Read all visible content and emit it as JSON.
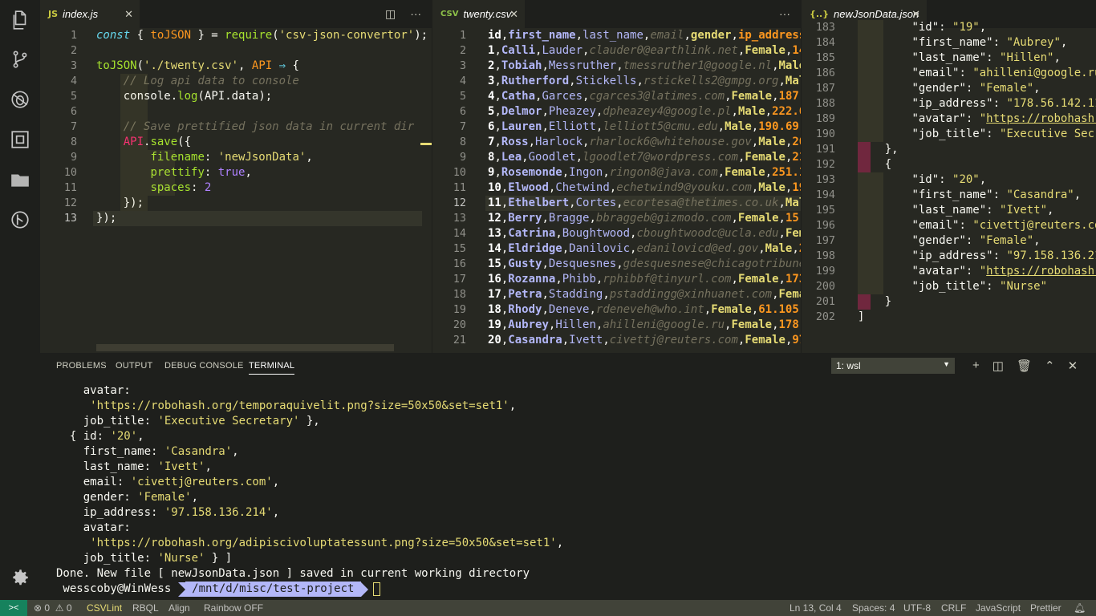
{
  "colors": {
    "editor_bg": "#272822",
    "sidebar_bg": "#1e1f1c",
    "status_bg": "#414339",
    "remote_bg": "#16825d"
  },
  "activity": [
    "files-icon",
    "source-control-icon",
    "debug-icon",
    "extensions-icon",
    "explorer-folder-icon",
    "git-graph-icon",
    "gear-icon"
  ],
  "editors": {
    "left": {
      "tab_label": "index.js",
      "tab_icon": "JS",
      "lines": [
        [
          [
            "kw",
            "const "
          ],
          [
            "pun",
            "{ "
          ],
          [
            "obj",
            "toJSON"
          ],
          [
            "pun",
            " } = "
          ],
          [
            "fn",
            "require"
          ],
          [
            "pun",
            "("
          ],
          [
            "str",
            "'csv-json-convertor'"
          ],
          [
            "pun",
            ");"
          ]
        ],
        [],
        [
          [
            "fn",
            "toJSON"
          ],
          [
            "pun",
            "("
          ],
          [
            "str",
            "'./twenty.csv'"
          ],
          [
            "pun",
            ", "
          ],
          [
            "obj",
            "API"
          ],
          [
            "pun",
            " "
          ],
          [
            "kw",
            "⇒"
          ],
          [
            "pun",
            " {"
          ]
        ],
        [
          [
            "pun",
            "    "
          ],
          [
            "cm",
            "// Log api data to console"
          ]
        ],
        [
          [
            "pun",
            "    "
          ],
          [
            "prop",
            "console"
          ],
          [
            "pun",
            "."
          ],
          [
            "fn",
            "log"
          ],
          [
            "pun",
            "("
          ],
          [
            "prop",
            "API"
          ],
          [
            "pun",
            "."
          ],
          [
            "prop",
            "data"
          ],
          [
            "pun",
            ");"
          ]
        ],
        [],
        [
          [
            "pun",
            "    "
          ],
          [
            "cm",
            "// Save prettified json data in current dir"
          ]
        ],
        [
          [
            "pun",
            "    "
          ],
          [
            "op",
            "API"
          ],
          [
            "pun",
            "."
          ],
          [
            "fn",
            "save"
          ],
          [
            "pun",
            "({"
          ]
        ],
        [
          [
            "pun",
            "        "
          ],
          [
            "fn",
            "filename"
          ],
          [
            "pun",
            ": "
          ],
          [
            "str",
            "'newJsonData'"
          ],
          [
            "pun",
            ","
          ]
        ],
        [
          [
            "pun",
            "        "
          ],
          [
            "fn",
            "prettify"
          ],
          [
            "pun",
            ": "
          ],
          [
            "num",
            "true"
          ],
          [
            "pun",
            ","
          ]
        ],
        [
          [
            "pun",
            "        "
          ],
          [
            "fn",
            "spaces"
          ],
          [
            "pun",
            ": "
          ],
          [
            "num",
            "2"
          ]
        ],
        [
          [
            "pun",
            "    "
          ],
          [
            "pun",
            "});"
          ]
        ],
        [
          [
            "pun",
            "});"
          ]
        ]
      ],
      "line_numbers": [
        "1",
        "2",
        "3",
        "4",
        "5",
        "6",
        "7",
        "8",
        "9",
        "10",
        "11",
        "12",
        "13"
      ],
      "active_line": 13
    },
    "middle": {
      "tab_label": "twenty.csv",
      "tab_icon": "CSV",
      "line_numbers": [
        "1",
        "2",
        "3",
        "4",
        "5",
        "6",
        "7",
        "8",
        "9",
        "10",
        "11",
        "12",
        "13",
        "14",
        "15",
        "16",
        "17",
        "18",
        "19",
        "20",
        "21"
      ],
      "active_line": 12,
      "rows": [
        [
          "id",
          "first_name",
          "last_name",
          "email",
          "gender",
          "ip_address"
        ],
        [
          "1",
          "Calli",
          "Lauder",
          "clauder0@earthlink.net",
          "Female",
          "14"
        ],
        [
          "2",
          "Tobiah",
          "Messruther",
          "tmessruther1@google.nl",
          "Male"
        ],
        [
          "3",
          "Rutherford",
          "Stickells",
          "rstickells2@gmpg.org",
          "Mal"
        ],
        [
          "4",
          "Catha",
          "Garces",
          "cgarces3@latimes.com",
          "Female",
          "187."
        ],
        [
          "5",
          "Delmor",
          "Pheazey",
          "dpheazey4@google.pl",
          "Male",
          "222.6"
        ],
        [
          "6",
          "Lauren",
          "Elliott",
          "lelliott5@cmu.edu",
          "Male",
          "190.69."
        ],
        [
          "7",
          "Ross",
          "Harlock",
          "rharlock6@whitehouse.gov",
          "Male",
          "20"
        ],
        [
          "8",
          "Lea",
          "Goodlet",
          "lgoodlet7@wordpress.com",
          "Female",
          "21"
        ],
        [
          "9",
          "Rosemonde",
          "Ingon",
          "ringon8@java.com",
          "Female",
          "251.1"
        ],
        [
          "10",
          "Elwood",
          "Chetwind",
          "echetwind9@youku.com",
          "Male",
          "19"
        ],
        [
          "11",
          "Ethelbert",
          "Cortes",
          "ecortesa@thetimes.co.uk",
          "Mal"
        ],
        [
          "12",
          "Berry",
          "Bragge",
          "bbraggeb@gizmodo.com",
          "Female",
          "15."
        ],
        [
          "13",
          "Catrina",
          "Boughtwood",
          "cboughtwoodc@ucla.edu",
          "Fem"
        ],
        [
          "14",
          "Eldridge",
          "Danilovic",
          "edanilovicd@ed.gov",
          "Male",
          "2"
        ],
        [
          "15",
          "Gusty",
          "Desquesnes",
          "gdesquesnese@chicagotribune"
        ],
        [
          "16",
          "Rozanna",
          "Phibb",
          "rphibbf@tinyurl.com",
          "Female",
          "173"
        ],
        [
          "17",
          "Petra",
          "Stadding",
          "pstaddingg@xinhuanet.com",
          "Fema"
        ],
        [
          "18",
          "Rhody",
          "Deneve",
          "rdeneveh@who.int",
          "Female",
          "61.105."
        ],
        [
          "19",
          "Aubrey",
          "Hillen",
          "ahilleni@google.ru",
          "Female",
          "178."
        ],
        [
          "20",
          "Casandra",
          "Ivett",
          "civettj@reuters.com",
          "Female",
          "97"
        ]
      ]
    },
    "right": {
      "tab_label": "newJsonData.json",
      "tab_icon": "{..}",
      "line_numbers": [
        "183",
        "184",
        "185",
        "186",
        "187",
        "188",
        "189",
        "190",
        "191",
        "192",
        "193",
        "194",
        "195",
        "196",
        "197",
        "198",
        "199",
        "200",
        "201",
        "202"
      ],
      "lines": [
        [
          [
            "pun",
            "        "
          ],
          [
            "key",
            "\"id\""
          ],
          [
            "pun",
            ": "
          ],
          [
            "str",
            "\"19\""
          ],
          [
            "pun",
            ","
          ]
        ],
        [
          [
            "pun",
            "        "
          ],
          [
            "key",
            "\"first_name\""
          ],
          [
            "pun",
            ": "
          ],
          [
            "str",
            "\"Aubrey\""
          ],
          [
            "pun",
            ","
          ]
        ],
        [
          [
            "pun",
            "        "
          ],
          [
            "key",
            "\"last_name\""
          ],
          [
            "pun",
            ": "
          ],
          [
            "str",
            "\"Hillen\""
          ],
          [
            "pun",
            ","
          ]
        ],
        [
          [
            "pun",
            "        "
          ],
          [
            "key",
            "\"email\""
          ],
          [
            "pun",
            ": "
          ],
          [
            "str",
            "\"ahilleni@google.ru\""
          ],
          [
            "pun",
            ","
          ]
        ],
        [
          [
            "pun",
            "        "
          ],
          [
            "key",
            "\"gender\""
          ],
          [
            "pun",
            ": "
          ],
          [
            "str",
            "\"Female\""
          ],
          [
            "pun",
            ","
          ]
        ],
        [
          [
            "pun",
            "        "
          ],
          [
            "key",
            "\"ip_address\""
          ],
          [
            "pun",
            ": "
          ],
          [
            "str",
            "\"178.56.142.118\""
          ],
          [
            "pun",
            ","
          ]
        ],
        [
          [
            "pun",
            "        "
          ],
          [
            "key",
            "\"avatar\""
          ],
          [
            "pun",
            ": "
          ],
          [
            "str",
            "\""
          ],
          [
            "link",
            "https://robohash.org/"
          ]
        ],
        [
          [
            "pun",
            "        "
          ],
          [
            "key",
            "\"job_title\""
          ],
          [
            "pun",
            ": "
          ],
          [
            "str",
            "\"Executive Secretar"
          ]
        ],
        [
          [
            "pun",
            "    "
          ],
          [
            "pun",
            "},"
          ]
        ],
        [
          [
            "pun",
            "    "
          ],
          [
            "pun",
            "{"
          ]
        ],
        [
          [
            "pun",
            "        "
          ],
          [
            "key",
            "\"id\""
          ],
          [
            "pun",
            ": "
          ],
          [
            "str",
            "\"20\""
          ],
          [
            "pun",
            ","
          ]
        ],
        [
          [
            "pun",
            "        "
          ],
          [
            "key",
            "\"first_name\""
          ],
          [
            "pun",
            ": "
          ],
          [
            "str",
            "\"Casandra\""
          ],
          [
            "pun",
            ","
          ]
        ],
        [
          [
            "pun",
            "        "
          ],
          [
            "key",
            "\"last_name\""
          ],
          [
            "pun",
            ": "
          ],
          [
            "str",
            "\"Ivett\""
          ],
          [
            "pun",
            ","
          ]
        ],
        [
          [
            "pun",
            "        "
          ],
          [
            "key",
            "\"email\""
          ],
          [
            "pun",
            ": "
          ],
          [
            "str",
            "\"civettj@reuters.com\""
          ],
          [
            "pun",
            ","
          ]
        ],
        [
          [
            "pun",
            "        "
          ],
          [
            "key",
            "\"gender\""
          ],
          [
            "pun",
            ": "
          ],
          [
            "str",
            "\"Female\""
          ],
          [
            "pun",
            ","
          ]
        ],
        [
          [
            "pun",
            "        "
          ],
          [
            "key",
            "\"ip_address\""
          ],
          [
            "pun",
            ": "
          ],
          [
            "str",
            "\"97.158.136.214\""
          ],
          [
            "pun",
            ","
          ]
        ],
        [
          [
            "pun",
            "        "
          ],
          [
            "key",
            "\"avatar\""
          ],
          [
            "pun",
            ": "
          ],
          [
            "str",
            "\""
          ],
          [
            "link",
            "https://robohash.org/"
          ]
        ],
        [
          [
            "pun",
            "        "
          ],
          [
            "key",
            "\"job_title\""
          ],
          [
            "pun",
            ": "
          ],
          [
            "str",
            "\"Nurse\""
          ]
        ],
        [
          [
            "pun",
            "    "
          ],
          [
            "pun",
            "}"
          ]
        ],
        [
          [
            "pun",
            "]"
          ]
        ]
      ]
    }
  },
  "panel": {
    "tabs": [
      "PROBLEMS",
      "OUTPUT",
      "DEBUG CONSOLE",
      "TERMINAL"
    ],
    "active_tab": "TERMINAL",
    "terminal_select": "1: wsl",
    "terminal_lines": [
      [
        [
          "p",
          "    avatar:"
        ]
      ],
      [
        [
          "p",
          "     "
        ],
        [
          "s",
          "'https://robohash.org/temporaquivelit.png?size=50x50&set=set1'"
        ],
        [
          "p",
          ","
        ]
      ],
      [
        [
          "p",
          "    job_title: "
        ],
        [
          "s",
          "'Executive Secretary'"
        ],
        [
          "p",
          " },"
        ]
      ],
      [
        [
          "p",
          "  { id: "
        ],
        [
          "s",
          "'20'"
        ],
        [
          "p",
          ","
        ]
      ],
      [
        [
          "p",
          "    first_name: "
        ],
        [
          "s",
          "'Casandra'"
        ],
        [
          "p",
          ","
        ]
      ],
      [
        [
          "p",
          "    last_name: "
        ],
        [
          "s",
          "'Ivett'"
        ],
        [
          "p",
          ","
        ]
      ],
      [
        [
          "p",
          "    email: "
        ],
        [
          "s",
          "'civettj@reuters.com'"
        ],
        [
          "p",
          ","
        ]
      ],
      [
        [
          "p",
          "    gender: "
        ],
        [
          "s",
          "'Female'"
        ],
        [
          "p",
          ","
        ]
      ],
      [
        [
          "p",
          "    ip_address: "
        ],
        [
          "s",
          "'97.158.136.214'"
        ],
        [
          "p",
          ","
        ]
      ],
      [
        [
          "p",
          "    avatar:"
        ]
      ],
      [
        [
          "p",
          "     "
        ],
        [
          "s",
          "'https://robohash.org/adipiscivoluptatessunt.png?size=50x50&set=set1'"
        ],
        [
          "p",
          ","
        ]
      ],
      [
        [
          "p",
          "    job_title: "
        ],
        [
          "s",
          "'Nurse'"
        ],
        [
          "p",
          " } ]"
        ]
      ],
      [
        [
          "p",
          "Done. New file [ newJsonData.json ] saved in current working directory"
        ]
      ]
    ],
    "prompt_user": " wesscoby@WinWess ",
    "prompt_path": " /mnt/d/misc/test-project "
  },
  "status": {
    "remote": "><",
    "errors": "0",
    "warnings": "0",
    "items_left": [
      "CSVLint",
      "RBQL",
      "Align",
      "Rainbow OFF"
    ],
    "position": "Ln 13, Col 4",
    "spaces": "Spaces: 4",
    "encoding": "UTF-8",
    "eol": "CRLF",
    "language": "JavaScript",
    "formatter": "Prettier"
  }
}
